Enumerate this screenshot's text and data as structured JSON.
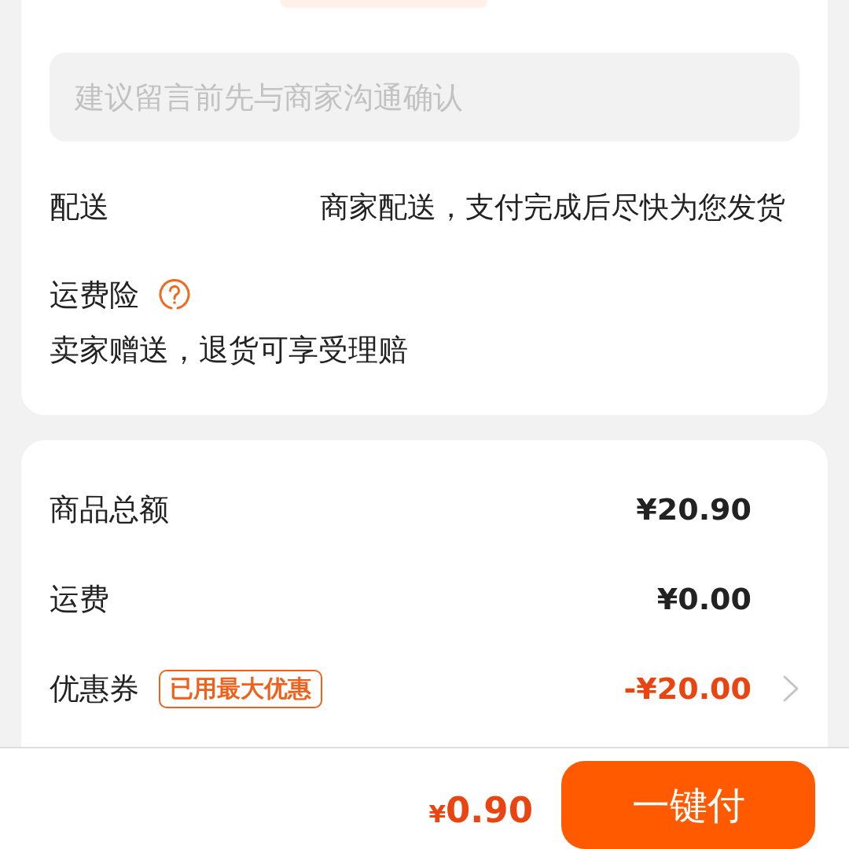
{
  "message_field": {
    "placeholder": "建议留言前先与商家沟通确认"
  },
  "delivery": {
    "label": "配送",
    "value": "商家配送，支付完成后尽快为您发货"
  },
  "shipping_insurance": {
    "label": "运费险",
    "note": "卖家赠送，退货可享受理赔"
  },
  "summary": [
    {
      "kind": "plain",
      "label": "商品总额",
      "value": "¥20.90"
    },
    {
      "kind": "plain",
      "label": "运费",
      "value": "¥0.00"
    },
    {
      "kind": "coupon",
      "label": "优惠券",
      "tag": "已用最大优惠",
      "value": "-¥20.00"
    }
  ],
  "footer": {
    "currency": "¥",
    "amount": "0.90",
    "pay_button": "一键付"
  }
}
